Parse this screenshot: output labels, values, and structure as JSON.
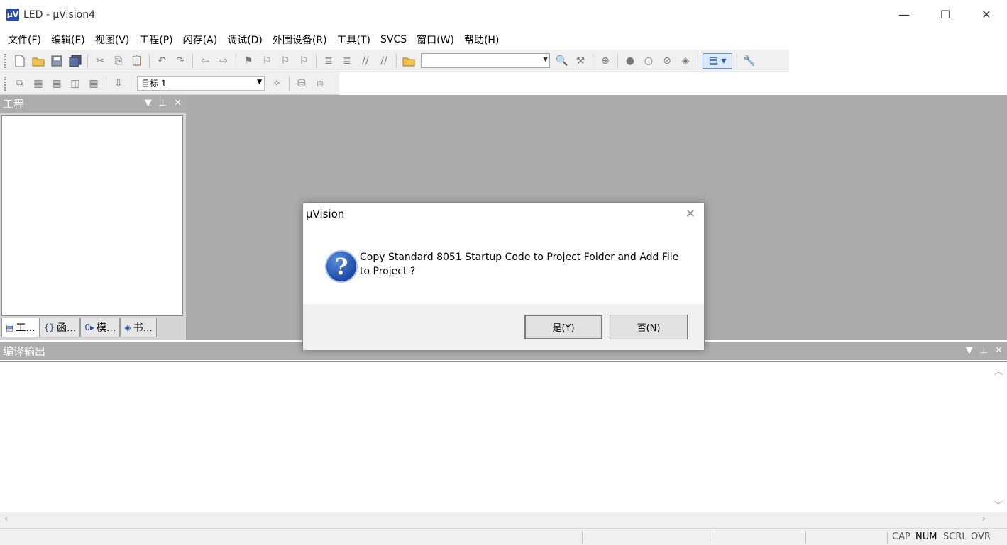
{
  "window": {
    "app_icon": "µV",
    "title": "LED - µVision4",
    "minimize_glyph": "—",
    "maximize_glyph": "☐",
    "close_glyph": "✕"
  },
  "menu": [
    "文件(F)",
    "编辑(E)",
    "视图(V)",
    "工程(P)",
    "闪存(A)",
    "调试(D)",
    "外围设备(R)",
    "工具(T)",
    "SVCS",
    "窗口(W)",
    "帮助(H)"
  ],
  "toolbar": {
    "target": "目标 1",
    "dropdown_arrow": "▼"
  },
  "project_panel": {
    "title": "工程",
    "tabs": [
      {
        "icon": "▤",
        "label": "工..."
      },
      {
        "icon": "{}",
        "label": "函..."
      },
      {
        "icon": "0▸",
        "label": "模..."
      },
      {
        "icon": "◈",
        "label": "书..."
      }
    ]
  },
  "output_panel": {
    "title": "编译输出"
  },
  "status_bar": {
    "indicators": [
      {
        "label": "CAP",
        "active": false
      },
      {
        "label": "NUM",
        "active": true
      },
      {
        "label": "SCRL",
        "active": false
      },
      {
        "label": "OVR",
        "active": false
      }
    ]
  },
  "dialog": {
    "title": "µVision",
    "close_glyph": "✕",
    "icon_glyph": "?",
    "message": "Copy Standard 8051 Startup Code to Project Folder and Add File to Project ?",
    "yes_label": "是(Y)",
    "no_label": "否(N)"
  },
  "panel_controls": {
    "dropdown": "▼",
    "pin": "⊥",
    "close": "✕"
  }
}
